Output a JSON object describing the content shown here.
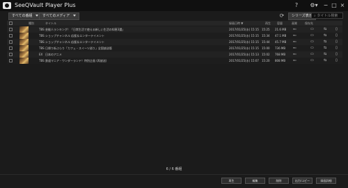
{
  "app": {
    "title": "SeeQVault Player Plus"
  },
  "titlebar": {
    "help": "?",
    "settings": "⚙▾",
    "minimize": "−",
    "maximize": "□",
    "close": "×"
  },
  "toolbar": {
    "filter1": "すべての番組",
    "filter2": "すべてのメディア",
    "series_button": "シリーズ表示",
    "search_placeholder": "タイトル検索"
  },
  "table": {
    "headers": [
      "",
      "",
      "種別",
      "タイトル",
      "",
      "録画日時",
      "再生",
      "容量",
      "画質",
      "保存先",
      "",
      ""
    ],
    "header_labels": {
      "type": "種別",
      "title": "タイトル",
      "date": "録画日時 ▼",
      "duration": "再生",
      "size": "容量",
      "quality": "画質",
      "dest": "保存先"
    },
    "rows": [
      {
        "type": "TBS",
        "title": "芸能人ランキング！「日常生活で使える新しい生活の知恵3選」",
        "date": "2017/01/25(水) 15:15",
        "duration": "15:25",
        "size": "21.6 MB",
        "quality": "HD"
      },
      {
        "type": "TBS",
        "title": "ショップチャンネル 応援＆エンターテイメント",
        "date": "2017/01/25(水) 15:15",
        "duration": "15:34",
        "size": "47.1 MB",
        "quality": "HD"
      },
      {
        "type": "TBS",
        "title": "ショップチャンネル 応援＆エンターテイメント",
        "date": "2017/01/25(水) 15:15",
        "duration": "15:44",
        "size": "45.7 MB",
        "quality": "HD"
      },
      {
        "type": "TBS",
        "title": "日帰り街ぶらり「カフェ・スイーツ巡り」全国放送版",
        "date": "2017/01/25(水) 15:15",
        "duration": "15:00",
        "size": "736 MB",
        "quality": "HD"
      },
      {
        "type": "EX",
        "title": "日本のアニメ",
        "date": "2017/01/25(水) 15:13",
        "duration": "15:02",
        "size": "768 MB",
        "quality": "HD"
      },
      {
        "type": "TBS",
        "title": "鉄道マニア・ワンダーランド！特別企画 (再放送)",
        "date": "2017/01/25(水) 15:07",
        "duration": "15:20",
        "size": "808 MB",
        "quality": "HD"
      }
    ]
  },
  "pager": {
    "text": "6 / 6 番組"
  },
  "buttons": {
    "play": "再生",
    "edit": "編集",
    "delete": "削除",
    "export": "出力/コピー",
    "details": "録画詳細"
  },
  "colors": {
    "background": "#1b1b1b",
    "titlebar": "#101010",
    "row": "#222222"
  }
}
